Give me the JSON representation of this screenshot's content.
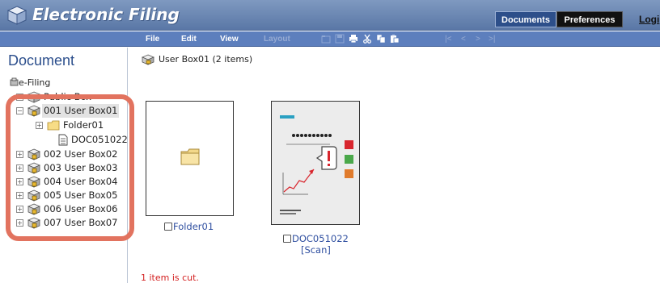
{
  "header": {
    "title": "Electronic Filing",
    "nav": {
      "documents": "Documents",
      "preferences": "Preferences",
      "login": "Logi"
    }
  },
  "menubar": {
    "file": "File",
    "edit": "Edit",
    "view": "View",
    "layout": "Layout",
    "pager": [
      "|<",
      "<",
      ">",
      ">|"
    ]
  },
  "sidebar": {
    "heading": "Document",
    "root": "e-Filing",
    "tree": [
      {
        "label": "Public Box"
      },
      {
        "label": "001 User Box01"
      },
      {
        "label": "Folder01"
      },
      {
        "label": "DOC051022"
      },
      {
        "label": "002 User Box02"
      },
      {
        "label": "003 User Box03"
      },
      {
        "label": "004 User Box04"
      },
      {
        "label": "005 User Box05"
      },
      {
        "label": "006 User Box06"
      },
      {
        "label": "007 User Box07"
      }
    ]
  },
  "main": {
    "path": "User Box01  (2 items)",
    "items": [
      {
        "name": "Folder01",
        "type": "folder"
      },
      {
        "name": "DOC051022",
        "subtitle": "[Scan]",
        "type": "document"
      }
    ],
    "status": "1 item is cut."
  },
  "colors": {
    "header": "#6a86b4",
    "menubar": "#5d7fbd",
    "highlight": "#e2735f",
    "link": "#2f4fa0",
    "status": "#d31f1f"
  }
}
